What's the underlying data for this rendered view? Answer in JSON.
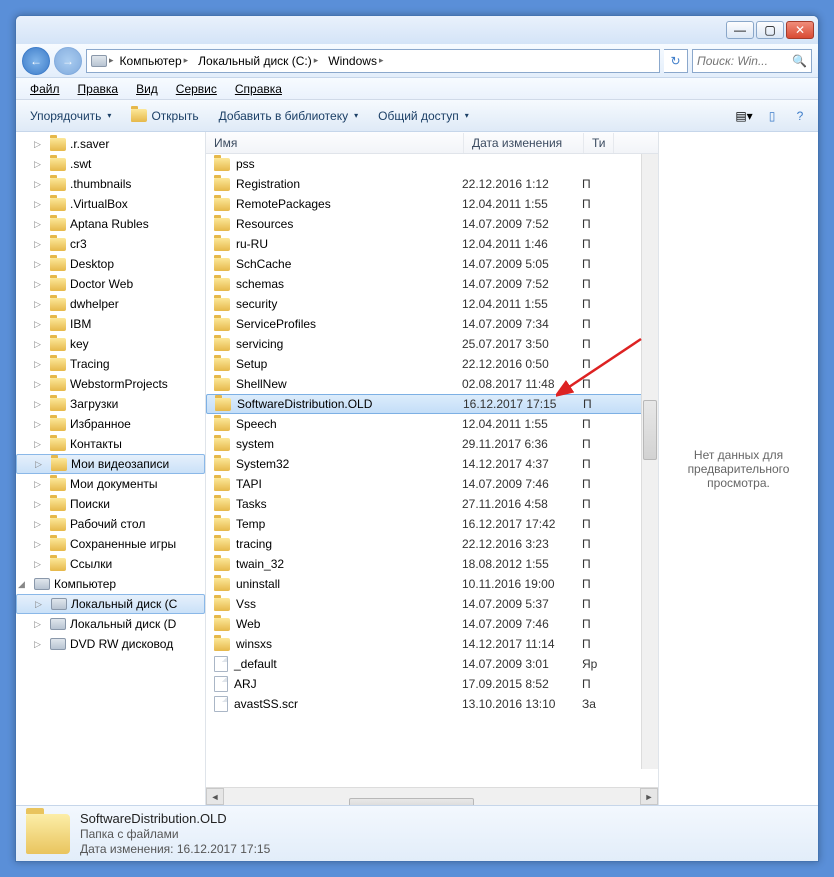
{
  "titlebar": {
    "min": "—",
    "max": "▢",
    "close": "✕"
  },
  "nav": {
    "back": "←",
    "forward": "→",
    "refresh": "↻"
  },
  "breadcrumbs": [
    "Компьютер",
    "Локальный диск (C:)",
    "Windows"
  ],
  "search": {
    "placeholder": "Поиск: Win..."
  },
  "menubar": [
    "Файл",
    "Правка",
    "Вид",
    "Сервис",
    "Справка"
  ],
  "toolbar": {
    "organize": "Упорядочить",
    "open": "Открыть",
    "add_to_library": "Добавить в библиотеку",
    "share": "Общий доступ"
  },
  "sidebar": {
    "items": [
      {
        "label": ".r.saver",
        "icon": "folder"
      },
      {
        "label": ".swt",
        "icon": "folder"
      },
      {
        "label": ".thumbnails",
        "icon": "folder"
      },
      {
        "label": ".VirtualBox",
        "icon": "folder"
      },
      {
        "label": "Aptana Rubles",
        "icon": "folder"
      },
      {
        "label": "cr3",
        "icon": "folder"
      },
      {
        "label": "Desktop",
        "icon": "folder"
      },
      {
        "label": "Doctor Web",
        "icon": "folder"
      },
      {
        "label": "dwhelper",
        "icon": "folder"
      },
      {
        "label": "IBM",
        "icon": "folder"
      },
      {
        "label": "key",
        "icon": "folder"
      },
      {
        "label": "Tracing",
        "icon": "folder"
      },
      {
        "label": "WebstormProjects",
        "icon": "folder"
      },
      {
        "label": "Загрузки",
        "icon": "folder"
      },
      {
        "label": "Избранное",
        "icon": "folder"
      },
      {
        "label": "Контакты",
        "icon": "folder"
      },
      {
        "label": "Мои видеозаписи",
        "icon": "folder",
        "sel": true
      },
      {
        "label": "Мои документы",
        "icon": "folder"
      },
      {
        "label": "Поиски",
        "icon": "folder"
      },
      {
        "label": "Рабочий стол",
        "icon": "folder"
      },
      {
        "label": "Сохраненные игры",
        "icon": "folder"
      },
      {
        "label": "Ссылки",
        "icon": "folder"
      }
    ],
    "computer": "Компьютер",
    "drives": [
      {
        "label": "Локальный диск (C",
        "sel": true
      },
      {
        "label": "Локальный диск (D"
      },
      {
        "label": "DVD RW дисковод"
      }
    ]
  },
  "columns": {
    "name": "Имя",
    "date": "Дата изменения",
    "type": "Ти"
  },
  "rows": [
    {
      "name": "pss",
      "date": "",
      "type": "",
      "icon": "folder"
    },
    {
      "name": "Registration",
      "date": "22.12.2016 1:12",
      "type": "П",
      "icon": "folder"
    },
    {
      "name": "RemotePackages",
      "date": "12.04.2011 1:55",
      "type": "П",
      "icon": "folder"
    },
    {
      "name": "Resources",
      "date": "14.07.2009 7:52",
      "type": "П",
      "icon": "folder"
    },
    {
      "name": "ru-RU",
      "date": "12.04.2011 1:46",
      "type": "П",
      "icon": "folder"
    },
    {
      "name": "SchCache",
      "date": "14.07.2009 5:05",
      "type": "П",
      "icon": "folder"
    },
    {
      "name": "schemas",
      "date": "14.07.2009 7:52",
      "type": "П",
      "icon": "folder"
    },
    {
      "name": "security",
      "date": "12.04.2011 1:55",
      "type": "П",
      "icon": "folder"
    },
    {
      "name": "ServiceProfiles",
      "date": "14.07.2009 7:34",
      "type": "П",
      "icon": "folder"
    },
    {
      "name": "servicing",
      "date": "25.07.2017 3:50",
      "type": "П",
      "icon": "folder"
    },
    {
      "name": "Setup",
      "date": "22.12.2016 0:50",
      "type": "П",
      "icon": "folder"
    },
    {
      "name": "ShellNew",
      "date": "02.08.2017 11:48",
      "type": "П",
      "icon": "folder"
    },
    {
      "name": "SoftwareDistribution.OLD",
      "date": "16.12.2017 17:15",
      "type": "П",
      "icon": "folder",
      "sel": true
    },
    {
      "name": "Speech",
      "date": "12.04.2011 1:55",
      "type": "П",
      "icon": "folder"
    },
    {
      "name": "system",
      "date": "29.11.2017 6:36",
      "type": "П",
      "icon": "folder"
    },
    {
      "name": "System32",
      "date": "14.12.2017 4:37",
      "type": "П",
      "icon": "folder"
    },
    {
      "name": "TAPI",
      "date": "14.07.2009 7:46",
      "type": "П",
      "icon": "folder"
    },
    {
      "name": "Tasks",
      "date": "27.11.2016 4:58",
      "type": "П",
      "icon": "folder"
    },
    {
      "name": "Temp",
      "date": "16.12.2017 17:42",
      "type": "П",
      "icon": "folder"
    },
    {
      "name": "tracing",
      "date": "22.12.2016 3:23",
      "type": "П",
      "icon": "folder"
    },
    {
      "name": "twain_32",
      "date": "18.08.2012 1:55",
      "type": "П",
      "icon": "folder"
    },
    {
      "name": "uninstall",
      "date": "10.11.2016 19:00",
      "type": "П",
      "icon": "folder"
    },
    {
      "name": "Vss",
      "date": "14.07.2009 5:37",
      "type": "П",
      "icon": "folder"
    },
    {
      "name": "Web",
      "date": "14.07.2009 7:46",
      "type": "П",
      "icon": "folder"
    },
    {
      "name": "winsxs",
      "date": "14.12.2017 11:14",
      "type": "П",
      "icon": "folder"
    },
    {
      "name": "_default",
      "date": "14.07.2009 3:01",
      "type": "Яр",
      "icon": "file"
    },
    {
      "name": "ARJ",
      "date": "17.09.2015 8:52",
      "type": "П",
      "icon": "file"
    },
    {
      "name": "avastSS.scr",
      "date": "13.10.2016 13:10",
      "type": "За",
      "icon": "file"
    }
  ],
  "preview": {
    "empty": "Нет данных для предварительного просмотра."
  },
  "status": {
    "name": "SoftwareDistribution.OLD",
    "type": "Папка с файлами",
    "date_label": "Дата изменения:",
    "date": "16.12.2017 17:15"
  }
}
